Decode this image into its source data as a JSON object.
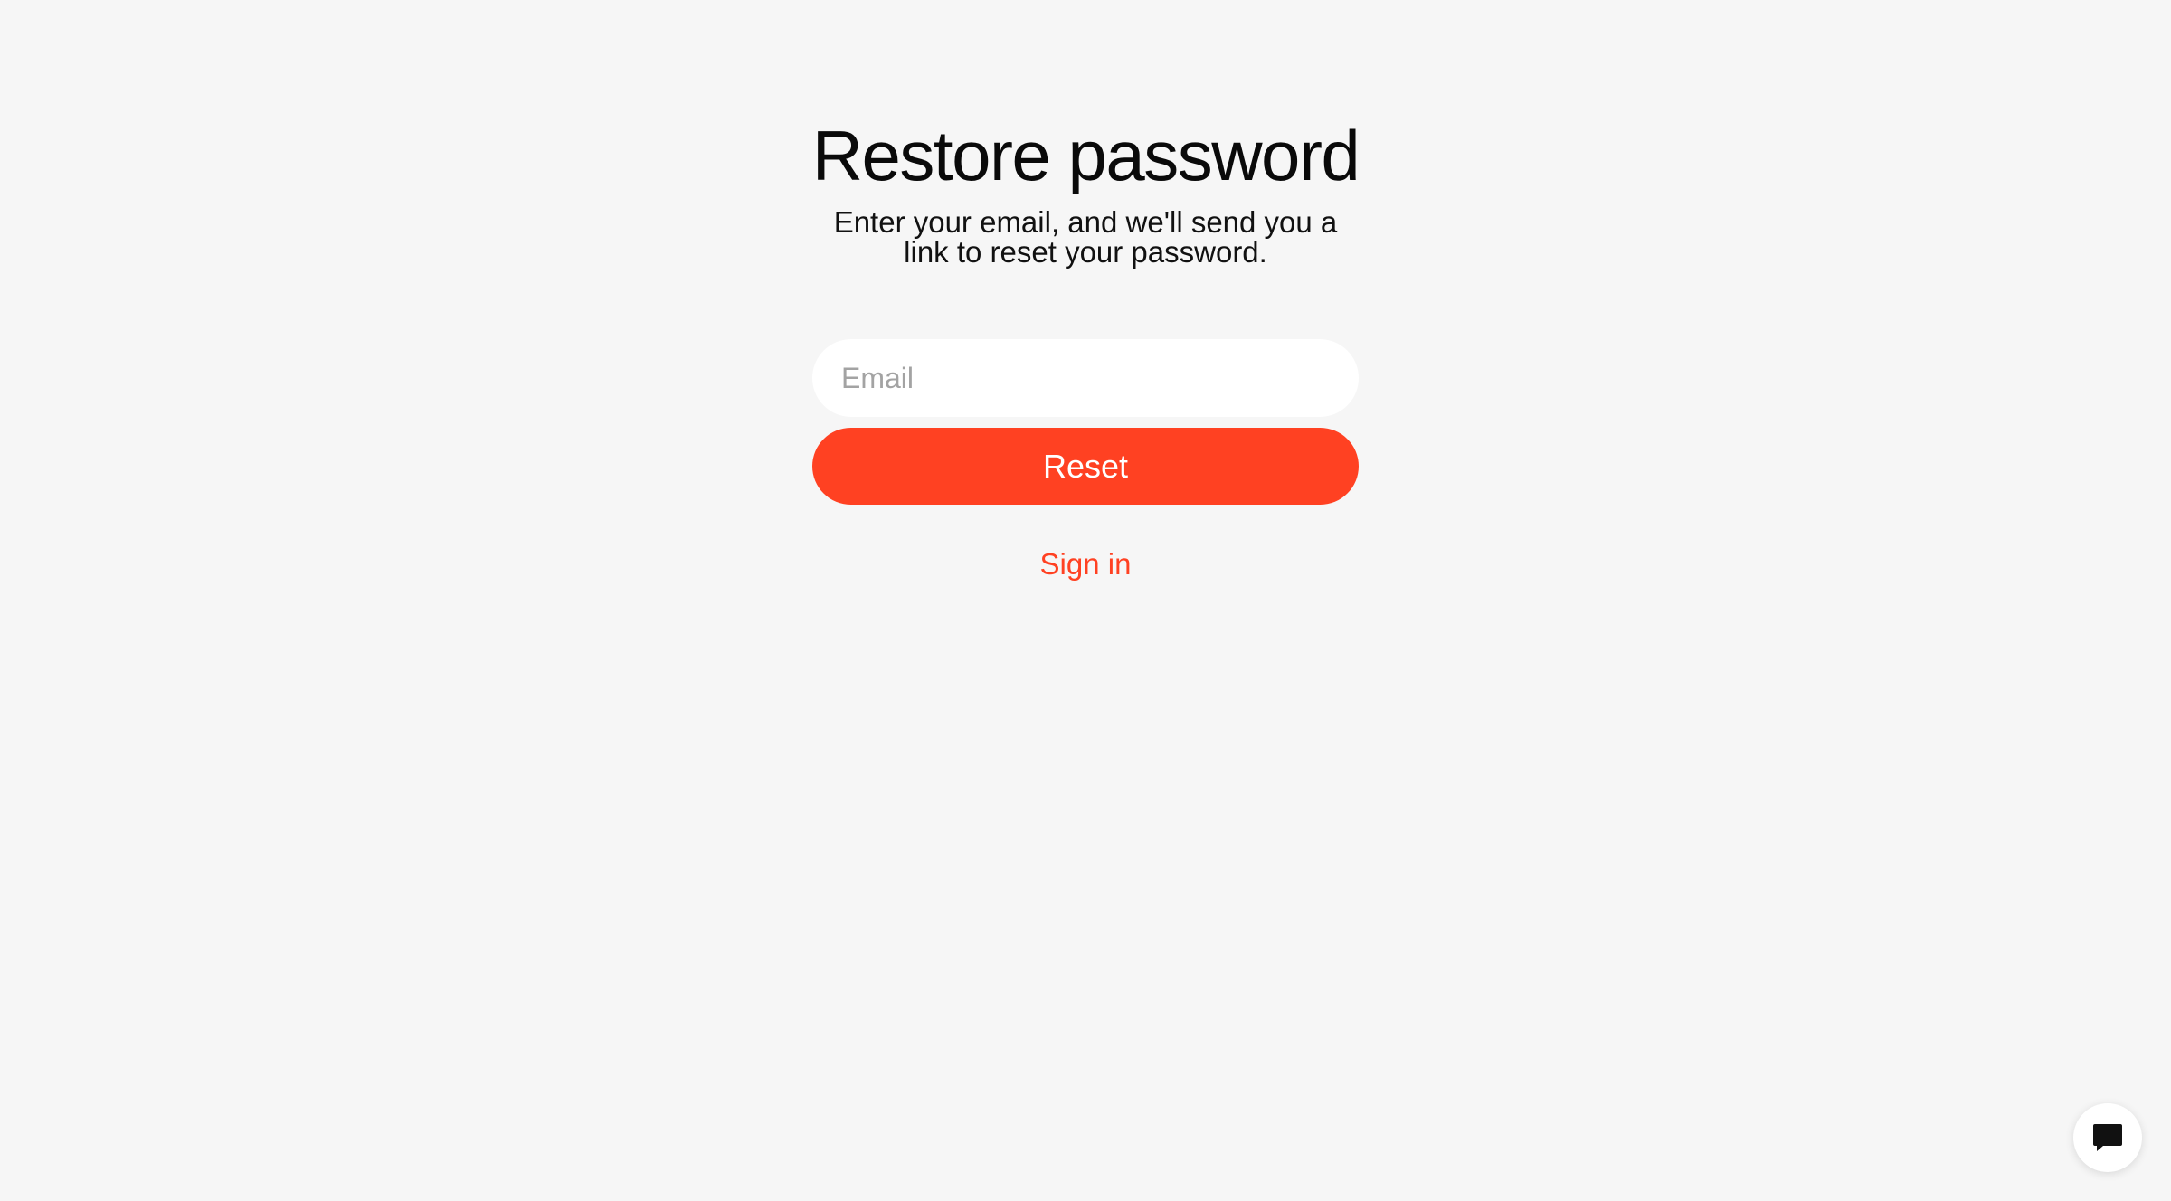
{
  "title": "Restore password",
  "subtitle": "Enter your email, and we'll send you a link to reset your password.",
  "form": {
    "email_placeholder": "Email",
    "email_value": "",
    "reset_label": "Reset"
  },
  "links": {
    "sign_in": "Sign in"
  },
  "chat": {
    "icon": "chat-bubble-icon"
  },
  "colors": {
    "accent": "#ff4122",
    "background": "#f6f6f6",
    "text": "#0a0a0a",
    "placeholder": "#a3a3a3"
  }
}
